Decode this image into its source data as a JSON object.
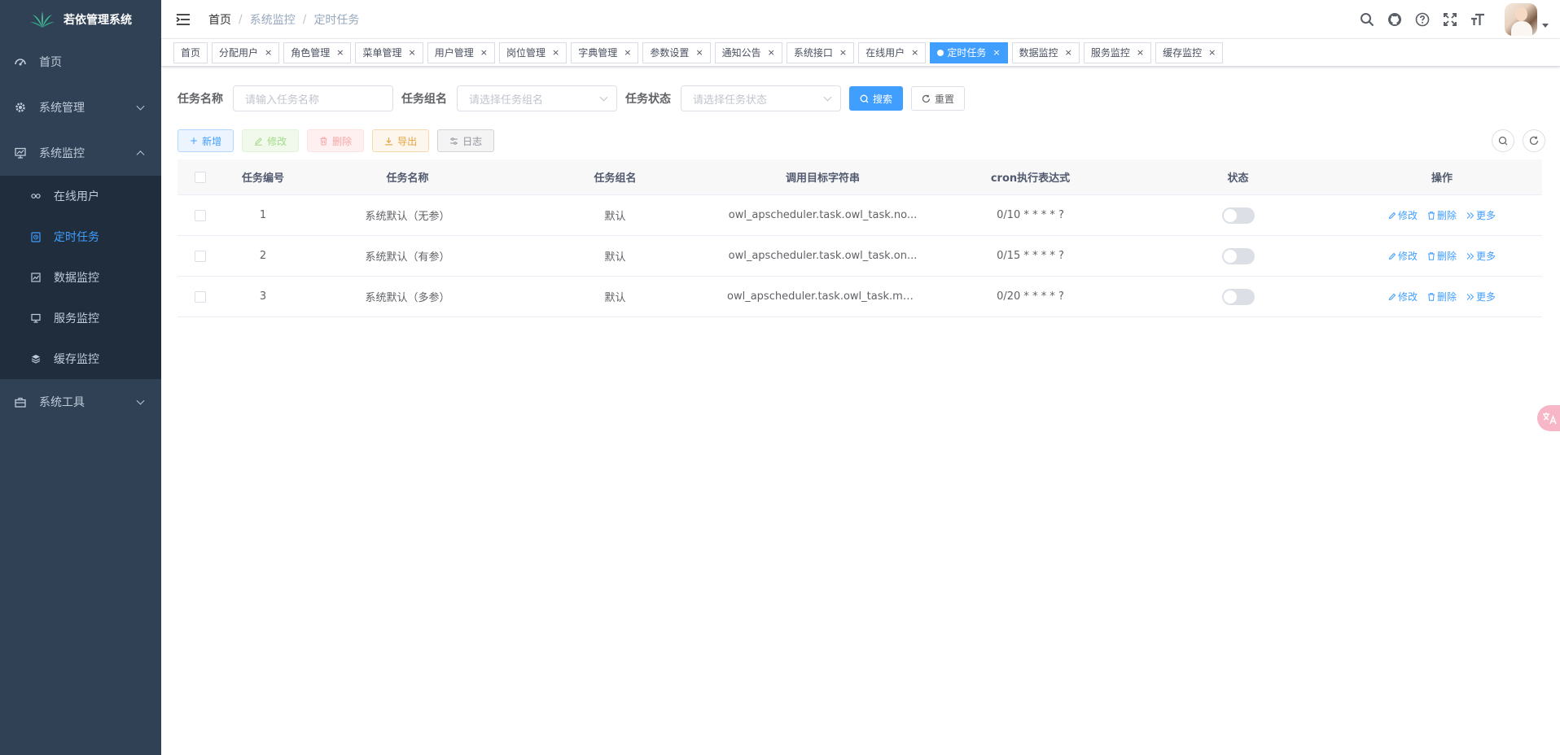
{
  "app": {
    "title": "若依管理系统",
    "accent": "#409eff",
    "sidebar_bg": "#304156"
  },
  "sidebar": {
    "items": [
      {
        "label": "首页",
        "icon": "dashboard-icon"
      },
      {
        "label": "系统管理",
        "icon": "gear-icon"
      },
      {
        "label": "系统监控",
        "icon": "monitor-icon"
      },
      {
        "label": "系统工具",
        "icon": "toolbox-icon"
      }
    ],
    "submenu": [
      {
        "label": "在线用户",
        "icon": "online-icon"
      },
      {
        "label": "定时任务",
        "icon": "job-icon"
      },
      {
        "label": "数据监控",
        "icon": "druid-icon"
      },
      {
        "label": "服务监控",
        "icon": "server-icon"
      },
      {
        "label": "缓存监控",
        "icon": "redis-icon"
      }
    ]
  },
  "breadcrumb": [
    "首页",
    "系统监控",
    "定时任务"
  ],
  "tags": [
    "首页",
    "分配用户",
    "角色管理",
    "菜单管理",
    "用户管理",
    "岗位管理",
    "字典管理",
    "参数设置",
    "通知公告",
    "系统接口",
    "在线用户",
    "定时任务",
    "数据监控",
    "服务监控",
    "缓存监控"
  ],
  "search": {
    "name_label": "任务名称",
    "name_placeholder": "请输入任务名称",
    "group_label": "任务组名",
    "group_placeholder": "请选择任务组名",
    "status_label": "任务状态",
    "status_placeholder": "请选择任务状态",
    "search_btn": "搜索",
    "reset_btn": "重置"
  },
  "toolbar": {
    "add": "新增",
    "edit": "修改",
    "delete": "删除",
    "export": "导出",
    "log": "日志"
  },
  "table": {
    "headers": [
      "任务编号",
      "任务名称",
      "任务组名",
      "调用目标字符串",
      "cron执行表达式",
      "状态",
      "操作"
    ],
    "rows": [
      {
        "id": "1",
        "name": "系统默认（无参）",
        "group": "默认",
        "target": "owl_apscheduler.task.owl_task.no...",
        "cron": "0/10 * * * * ?",
        "enabled": false
      },
      {
        "id": "2",
        "name": "系统默认（有参）",
        "group": "默认",
        "target": "owl_apscheduler.task.owl_task.on...",
        "cron": "0/15 * * * * ?",
        "enabled": false
      },
      {
        "id": "3",
        "name": "系统默认（多参）",
        "group": "默认",
        "target": "owl_apscheduler.task.owl_task.mu...",
        "cron": "0/20 * * * * ?",
        "enabled": false
      }
    ],
    "ops": {
      "edit": "修改",
      "delete": "删除",
      "more": "更多"
    }
  }
}
